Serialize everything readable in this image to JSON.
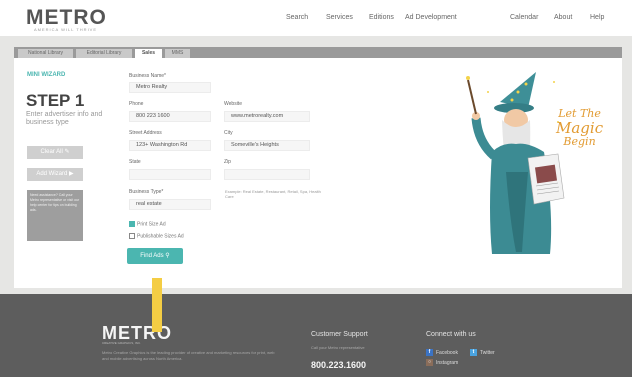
{
  "header": {
    "logo": "METRO",
    "tagline": "AMERICA WILL THRIVE",
    "nav": [
      "Search",
      "Services",
      "Editions",
      "Ad Development",
      "Calendar",
      "About",
      "Help"
    ]
  },
  "tabs": [
    "National Library",
    "Editorial Library",
    "Sales",
    "MMS"
  ],
  "sidebar": {
    "mini_title": "MINI WIZARD",
    "step": "STEP 1",
    "description": "Enter advertiser info and business type",
    "buttons": [
      "Clear All",
      "Add Wizard"
    ],
    "note": "Need assistance? Call your Metro representative or visit our help center for tips on building ads."
  },
  "form": {
    "business_name": {
      "label": "Business Name*",
      "value": "Metro Realty"
    },
    "phone": {
      "label": "Phone",
      "value": "800 223 1600"
    },
    "website": {
      "label": "Website",
      "value": "www.metrorealty.com"
    },
    "street": {
      "label": "Street Address",
      "value": "123+ Washington Rd"
    },
    "city": {
      "label": "City",
      "value": "Someville's Heights"
    },
    "state": {
      "label": "State",
      "value": ""
    },
    "zip": {
      "label": "Zip",
      "value": ""
    },
    "business_type": {
      "label": "Business Type*",
      "value": "real estate"
    },
    "business_type_hint": "Example: Real Estate, Restaurant, Retail, Spa, Health Care",
    "checkboxes": [
      {
        "label": "Print Size Ad",
        "checked": true
      },
      {
        "label": "Publishable Sizes Ad",
        "checked": false
      }
    ],
    "submit": "Find Ads"
  },
  "promo": {
    "lines": [
      "Let The",
      "Magic",
      "Begin"
    ]
  },
  "footer": {
    "logo": "METRO",
    "logo_small": "CREATIVE GRAPHICS, INC.",
    "text": "Metro Creative Graphics is the leading provider of creative and marketing resources for print, web and mobile advertising across North America.",
    "support_title": "Customer Support",
    "support_text": "Call your Metro representative",
    "phone": "800.223.1600",
    "connect_title": "Connect with us",
    "social": [
      "Facebook",
      "Twitter",
      "Instagram"
    ]
  },
  "colors": {
    "accent": "#4bb6b0",
    "magic": "#e29b32",
    "footer": "#5d5d5d"
  }
}
